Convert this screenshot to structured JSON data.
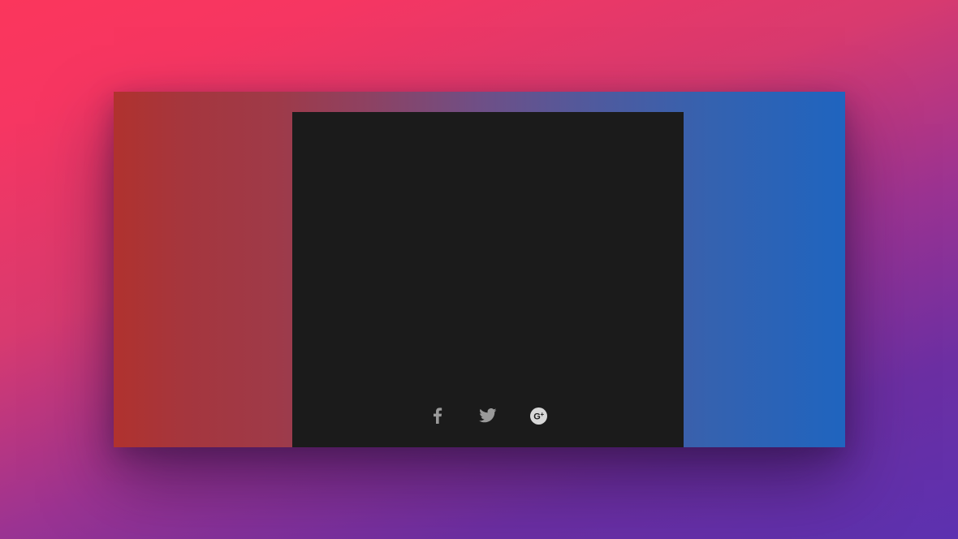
{
  "card": {
    "gradient_start": "#b0322e",
    "gradient_end": "#1f64bf"
  },
  "panel": {
    "background": "#1b1b1b"
  },
  "social": {
    "items": [
      {
        "icon": "facebook-icon"
      },
      {
        "icon": "twitter-icon"
      },
      {
        "icon": "google-plus-icon"
      }
    ]
  }
}
